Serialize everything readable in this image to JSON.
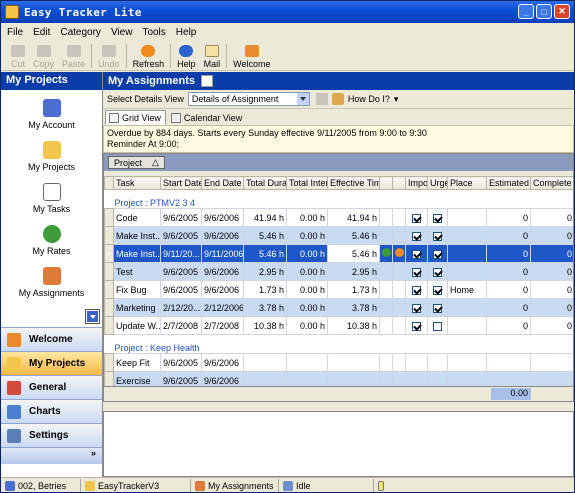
{
  "window": {
    "title": "Easy Tracker Lite"
  },
  "menu": [
    "File",
    "Edit",
    "Category",
    "View",
    "Tools",
    "Help"
  ],
  "toolbar": {
    "cut": "Cut",
    "copy": "Copy",
    "paste": "Paste",
    "undo": "Undo",
    "refresh": "Refresh",
    "help": "Help",
    "mail": "Mail",
    "welcome": "Welcome"
  },
  "sidebar": {
    "title": "My Projects",
    "items": [
      "My Account",
      "My Projects",
      "My Tasks",
      "My Rates",
      "My Assignments"
    ],
    "nav": [
      "Welcome",
      "My Projects",
      "General",
      "Charts",
      "Settings"
    ],
    "more": "»"
  },
  "main": {
    "title": "My Assignments",
    "details_label": "Select Details View",
    "details_value": "Details of Assignment",
    "howdoi": "How Do I?",
    "tabs": [
      "Grid View",
      "Calendar View"
    ],
    "info_line1": "Overdue by 884 days. Starts every Sunday effective 9/11/2005 from 9:00 to 9:30",
    "info_line2": "Reminder At 9:00;",
    "groupby": "Project",
    "columns": [
      "Task",
      "Start Date",
      "End Date",
      "Total Dura",
      "Total Inter",
      "Effective Tim",
      "",
      "",
      "Impo",
      "Urge",
      "Place",
      "Estimated",
      "Complete %"
    ],
    "groups": [
      {
        "label": "Project : PTMV2 3 4",
        "rows": [
          {
            "task": "Code",
            "start": "9/6/2005",
            "end": "9/6/2006",
            "total": "41.94 h",
            "inter": "0.00 h",
            "eff": "41.94 h",
            "imp": true,
            "urg": true,
            "place": "",
            "est": "0",
            "comp": "0"
          },
          {
            "task": "Make Inst...",
            "start": "9/6/2005",
            "end": "9/6/2006",
            "total": "5.46 h",
            "inter": "0.00 h",
            "eff": "5.46 h",
            "imp": true,
            "urg": true,
            "place": "",
            "est": "0",
            "comp": "0"
          },
          {
            "task": "Make Inst...",
            "start": "9/11/20...",
            "end": "9/11/2006",
            "total": "5.46 h",
            "inter": "0.00 h",
            "eff": "5.46 h",
            "imp": true,
            "urg": true,
            "place": "",
            "est": "0",
            "comp": "0"
          },
          {
            "task": "Test",
            "start": "9/6/2005",
            "end": "9/6/2006",
            "total": "2.95 h",
            "inter": "0.00 h",
            "eff": "2.95 h",
            "imp": true,
            "urg": true,
            "place": "",
            "est": "0",
            "comp": "0"
          },
          {
            "task": "Fix Bug",
            "start": "9/6/2005",
            "end": "9/6/2006",
            "total": "1.73 h",
            "inter": "0.00 h",
            "eff": "1.73 h",
            "imp": true,
            "urg": true,
            "place": "Home",
            "est": "0",
            "comp": "0"
          },
          {
            "task": "Marketing",
            "start": "2/12/20...",
            "end": "2/12/2006",
            "total": "3.78 h",
            "inter": "0.00 h",
            "eff": "3.78 h",
            "imp": true,
            "urg": true,
            "place": "",
            "est": "0",
            "comp": "0"
          },
          {
            "task": "Update W...",
            "start": "2/7/2008",
            "end": "2/7/2008",
            "total": "10.38 h",
            "inter": "0.00 h",
            "eff": "10.38 h",
            "imp": true,
            "urg": false,
            "place": "",
            "est": "0",
            "comp": "0"
          }
        ]
      },
      {
        "label": "Project : Keep Health",
        "rows": [
          {
            "task": "Keep Fit",
            "start": "9/6/2005",
            "end": "9/6/2006"
          },
          {
            "task": "Exercise",
            "start": "9/6/2005",
            "end": "9/6/2006"
          }
        ]
      }
    ],
    "total": "0.00"
  },
  "statusbar": [
    "002, Betries",
    "EasyTrackerV3",
    "My Assignments",
    "Idle"
  ]
}
